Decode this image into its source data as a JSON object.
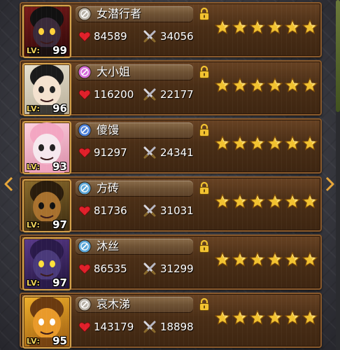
{
  "heroes": [
    {
      "name": "女潜行者",
      "level_label": "LV:",
      "level": "99",
      "hp": "84589",
      "atk": "34056",
      "stars": 6,
      "class_icon": "dagger-class-icon",
      "icon_color": "#b9b3a8",
      "theme": "dark-red"
    },
    {
      "name": "大小姐",
      "level_label": "LV:",
      "level": "96",
      "hp": "116200",
      "atk": "22177",
      "stars": 6,
      "class_icon": "staff-class-icon",
      "icon_color": "#d46ad8",
      "theme": "girl"
    },
    {
      "name": "傻馒",
      "level_label": "LV:",
      "level": "93",
      "hp": "91297",
      "atk": "24341",
      "stars": 6,
      "class_icon": "shield-class-icon",
      "icon_color": "#4a7fd8",
      "theme": "pink"
    },
    {
      "name": "方砖",
      "level_label": "LV:",
      "level": "97",
      "hp": "81736",
      "atk": "31031",
      "stars": 6,
      "class_icon": "orb-class-icon",
      "icon_color": "#5aa6d8",
      "theme": "warrior"
    },
    {
      "name": "沐丝",
      "level_label": "LV:",
      "level": "97",
      "hp": "86535",
      "atk": "31299",
      "stars": 6,
      "class_icon": "orb-class-icon",
      "icon_color": "#5aa6d8",
      "theme": "purple"
    },
    {
      "name": "哀木涕",
      "level_label": "LV:",
      "level": "95",
      "hp": "143179",
      "atk": "18898",
      "stars": 6,
      "class_icon": "shield-class-icon",
      "icon_color": "#b9b3a8",
      "theme": "bull"
    }
  ],
  "icons": {
    "hp": "heart-icon",
    "atk": "crossed-swords-icon",
    "lock": "lock-icon",
    "star": "star-icon",
    "nav_left": "chevron-left-icon",
    "nav_right": "chevron-right-icon"
  },
  "colors": {
    "accent_gold": "#f2c230",
    "heart_red": "#e0202a"
  }
}
